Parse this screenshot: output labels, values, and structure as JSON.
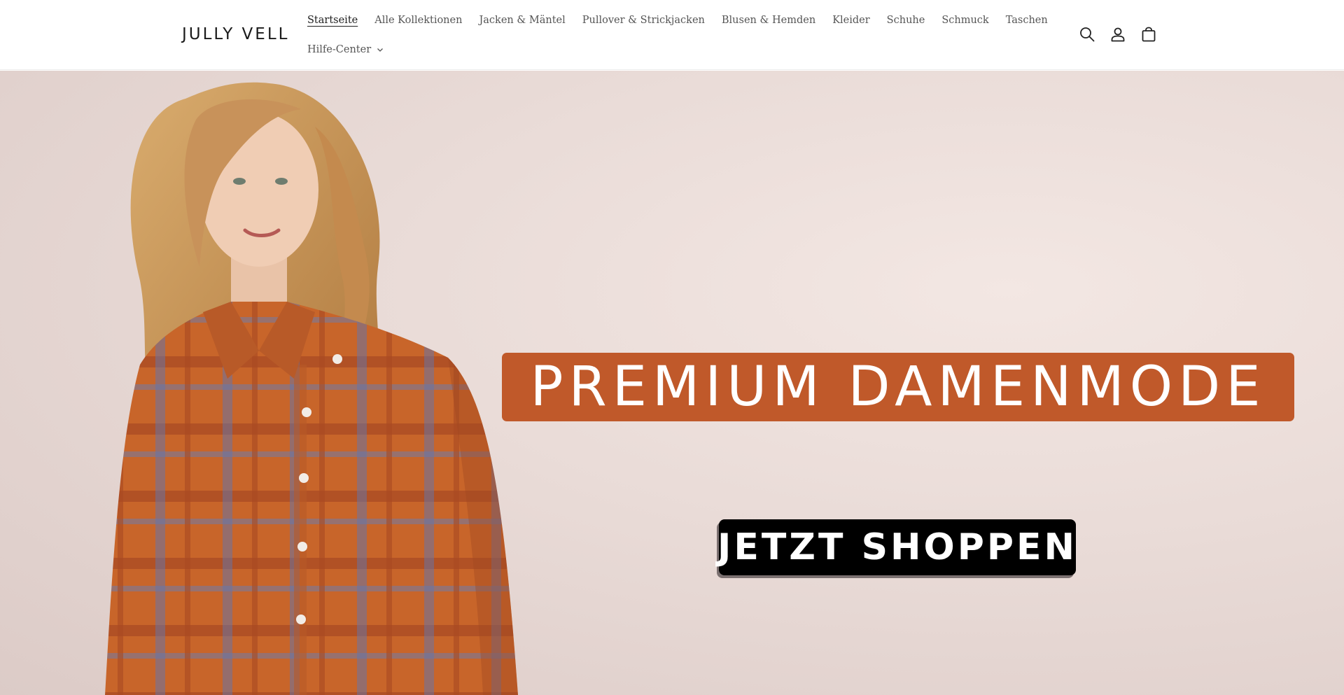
{
  "brand": {
    "name": "JULLY VELL"
  },
  "nav": {
    "row1": [
      {
        "label": "Startseite",
        "active": true
      },
      {
        "label": "Alle Kollektionen"
      },
      {
        "label": "Jacken & Mäntel"
      },
      {
        "label": "Pullover & Strickjacken"
      },
      {
        "label": "Blusen & Hemden"
      },
      {
        "label": "Kleider"
      },
      {
        "label": "Schuhe"
      },
      {
        "label": "Schmuck"
      },
      {
        "label": "Taschen"
      }
    ],
    "row2": [
      {
        "label": "Hilfe-Center",
        "icon": "chevron-down-icon"
      }
    ]
  },
  "header_icons": [
    "search-icon",
    "account-icon",
    "cart-icon"
  ],
  "hero": {
    "headline": "PREMIUM DAMENMODE",
    "cta_label": "JETZT SHOPPEN",
    "colors": {
      "banner": "#c0592a",
      "cta": "#000000",
      "background": "#e9dbd7"
    }
  }
}
